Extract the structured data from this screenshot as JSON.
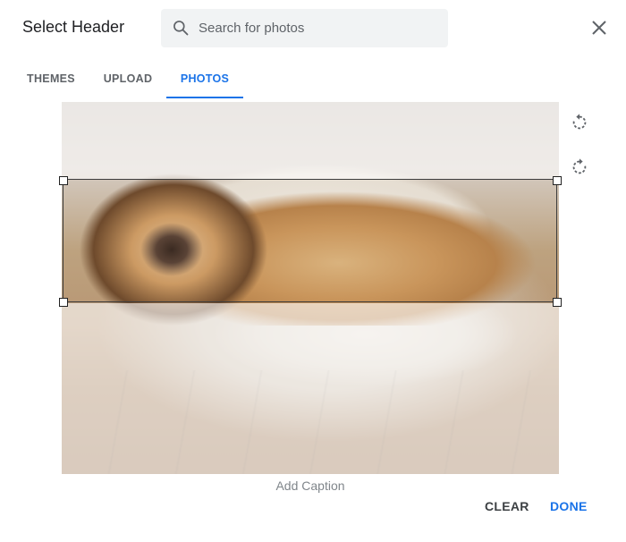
{
  "dialog": {
    "title": "Select Header",
    "close_icon": "close-icon"
  },
  "search": {
    "placeholder": "Search for photos",
    "value": "",
    "icon": "search-icon"
  },
  "tabs": [
    {
      "label": "THEMES",
      "active": false
    },
    {
      "label": "UPLOAD",
      "active": false
    },
    {
      "label": "PHOTOS",
      "active": true
    }
  ],
  "editor": {
    "rotate_left_icon": "rotate-left-icon",
    "rotate_right_icon": "rotate-right-icon",
    "caption_placeholder": "Add Caption"
  },
  "actions": {
    "clear_label": "CLEAR",
    "done_label": "DONE"
  },
  "colors": {
    "accent": "#1a73e8",
    "search_bg": "#f1f3f4"
  }
}
